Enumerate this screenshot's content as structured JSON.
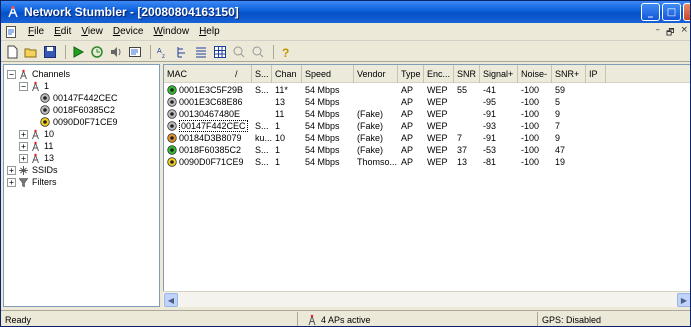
{
  "window": {
    "title": "Network Stumbler - [20080804163150]"
  },
  "menu": {
    "items": [
      "File",
      "Edit",
      "View",
      "Device",
      "Window",
      "Help"
    ]
  },
  "toolbar": {
    "icons": [
      "new-icon",
      "open-icon",
      "save-icon",
      "play-icon",
      "auto-config-icon",
      "sound-icon",
      "properties-icon",
      "sort-icon",
      "filter-icon",
      "list-view-icon",
      "grid-view-icon",
      "zoom-in-icon",
      "zoom-out-icon",
      "help-icon"
    ]
  },
  "tree": {
    "nodes": [
      {
        "label": "Channels",
        "icon": "antenna-icon",
        "expander": "−"
      },
      {
        "label": "1",
        "icon": "antenna-icon",
        "expander": "−"
      },
      {
        "label": "00147F442CEC",
        "icon": "ap-gray-icon",
        "expander": ""
      },
      {
        "label": "0018F60385C2",
        "icon": "ap-gray-icon",
        "expander": ""
      },
      {
        "label": "0090D0F71CE9",
        "icon": "ap-yellow-icon",
        "expander": ""
      },
      {
        "label": "10",
        "icon": "antenna-icon",
        "expander": "+"
      },
      {
        "label": "11",
        "icon": "antenna-icon",
        "expander": "+"
      },
      {
        "label": "13",
        "icon": "antenna-icon",
        "expander": "+"
      },
      {
        "label": "SSIDs",
        "icon": "ssid-icon",
        "expander": "+"
      },
      {
        "label": "Filters",
        "icon": "filter-icon",
        "expander": "+"
      }
    ]
  },
  "list": {
    "columns": [
      "MAC",
      "/",
      "S...",
      "Chan",
      "Speed",
      "Vendor",
      "Type",
      "Enc...",
      "SNR",
      "Signal+",
      "Noise-",
      "SNR+",
      "IP"
    ],
    "rows": [
      {
        "status": "green",
        "mac": "0001E3C5F29B",
        "ssid": "S...",
        "chan": "11*",
        "speed": "54 Mbps",
        "vendor": "",
        "type": "AP",
        "enc": "WEP",
        "snr": "55",
        "signal": "-41",
        "noise": "-100",
        "snrplus": "59"
      },
      {
        "status": "gray",
        "mac": "0001E3C68E86",
        "ssid": "",
        "chan": "13",
        "speed": "54 Mbps",
        "vendor": "",
        "type": "AP",
        "enc": "WEP",
        "snr": "",
        "signal": "-95",
        "noise": "-100",
        "snrplus": "5"
      },
      {
        "status": "gray",
        "mac": "00130467480E",
        "ssid": "",
        "chan": "11",
        "speed": "54 Mbps",
        "vendor": "(Fake)",
        "type": "AP",
        "enc": "WEP",
        "snr": "",
        "signal": "-91",
        "noise": "-100",
        "snrplus": "9"
      },
      {
        "status": "gray",
        "mac": "00147F442CEC",
        "ssid": "S...",
        "chan": "1",
        "speed": "54 Mbps",
        "vendor": "(Fake)",
        "type": "AP",
        "enc": "WEP",
        "snr": "",
        "signal": "-93",
        "noise": "-100",
        "snrplus": "7"
      },
      {
        "status": "orange",
        "mac": "00184D3B8079",
        "ssid": "ku...",
        "chan": "10",
        "speed": "54 Mbps",
        "vendor": "(Fake)",
        "type": "AP",
        "enc": "WEP",
        "snr": "7",
        "signal": "-91",
        "noise": "-100",
        "snrplus": "9"
      },
      {
        "status": "green",
        "mac": "0018F60385C2",
        "ssid": "S...",
        "chan": "1",
        "speed": "54 Mbps",
        "vendor": "(Fake)",
        "type": "AP",
        "enc": "WEP",
        "snr": "37",
        "signal": "-53",
        "noise": "-100",
        "snrplus": "47"
      },
      {
        "status": "yellow",
        "mac": "0090D0F71CE9",
        "ssid": "S...",
        "chan": "1",
        "speed": "54 Mbps",
        "vendor": "Thomso...",
        "type": "AP",
        "enc": "WEP",
        "snr": "13",
        "signal": "-81",
        "noise": "-100",
        "snrplus": "19"
      }
    ],
    "status_colors": {
      "green": "#2fbf2f",
      "gray": "#bfbfbf",
      "orange": "#e8922a",
      "yellow": "#f5d21e"
    }
  },
  "status": {
    "left": "Ready",
    "center": "4 APs active",
    "right": "GPS: Disabled"
  }
}
